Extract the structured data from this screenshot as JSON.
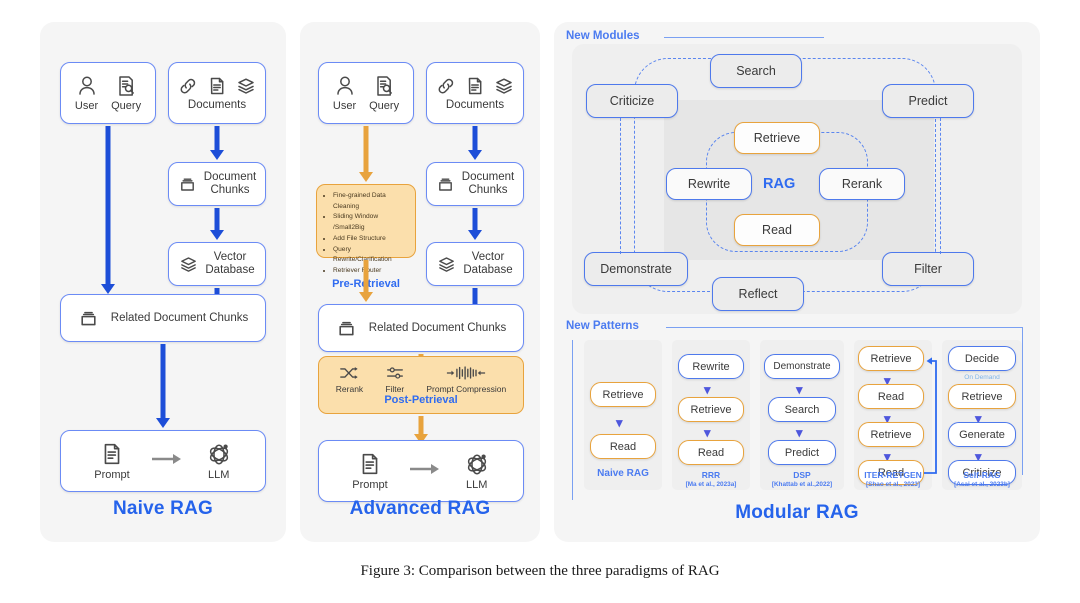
{
  "caption": "Figure 3: Comparison between the three paradigms of RAG",
  "colors": {
    "accent_blue": "#2563eb",
    "node_border_blue": "#6b8bf5",
    "arrow_blue": "#1d4ed8",
    "arrow_orange": "#e8a33d",
    "orange_fill": "#fbdfac",
    "panel_bg": "#f5f5f5",
    "module_bg": "#ececec"
  },
  "naive": {
    "title": "Naive RAG",
    "input_user": "User",
    "input_query": "Query",
    "input_documents": "Documents",
    "document_chunks": "Document\nChunks",
    "document_chunks_line1": "Document",
    "document_chunks_line2": "Chunks",
    "vector_database_line1": "Vector",
    "vector_database_line2": "Database",
    "related_chunks": "Related Document Chunks",
    "prompt": "Prompt",
    "llm": "LLM",
    "icons": [
      "user-icon",
      "query-icon",
      "link-icon",
      "document-icon",
      "layers-icon",
      "chunks-icon",
      "layers-icon",
      "prompt-icon",
      "llm-icon",
      "right-arrow-icon"
    ]
  },
  "advanced": {
    "title": "Advanced RAG",
    "input_user": "User",
    "input_query": "Query",
    "input_documents": "Documents",
    "document_chunks_line1": "Document",
    "document_chunks_line2": "Chunks",
    "vector_database_line1": "Vector",
    "vector_database_line2": "Database",
    "related_chunks": "Related Document Chunks",
    "pre_retrieval": {
      "label": "Pre-Retrieval",
      "bullets": [
        "Fine-grained Data Cleaning",
        "Sliding Window /Small2Big",
        "Add File Structure",
        "Query Rewrite/Clarification",
        "Retriever Router"
      ]
    },
    "post_retrieval": {
      "label": "Post-Petrieval",
      "items": [
        {
          "caption": "Rerank",
          "icon": "shuffle-icon"
        },
        {
          "caption": "Filter",
          "icon": "sliders-icon"
        },
        {
          "caption": "Prompt Compression",
          "icon": "compress-icon"
        }
      ]
    },
    "prompt": "Prompt",
    "llm": "LLM"
  },
  "modular": {
    "title": "Modular RAG",
    "new_modules_label": "New Modules",
    "new_patterns_label": "New Patterns",
    "rag_core_label": "RAG",
    "outer_modules": [
      {
        "name": "Search"
      },
      {
        "name": "Criticize"
      },
      {
        "name": "Predict"
      },
      {
        "name": "Demonstrate"
      },
      {
        "name": "Filter"
      },
      {
        "name": "Reflect"
      }
    ],
    "core_modules": [
      {
        "name": "Retrieve",
        "accent": "orange"
      },
      {
        "name": "Rewrite",
        "accent": "blue"
      },
      {
        "name": "Rerank",
        "accent": "blue"
      },
      {
        "name": "Read",
        "accent": "orange"
      }
    ],
    "patterns": [
      {
        "name": "Naive RAG",
        "citation": "",
        "steps": [
          {
            "label": "Retrieve",
            "accent": "orange"
          },
          {
            "label": "Read",
            "accent": "orange"
          }
        ]
      },
      {
        "name": "RRR",
        "citation": "[Ma et al., 2023a]",
        "steps": [
          {
            "label": "Rewrite",
            "accent": "blue"
          },
          {
            "label": "Retrieve",
            "accent": "orange"
          },
          {
            "label": "Read",
            "accent": "orange"
          }
        ]
      },
      {
        "name": "DSP",
        "citation": "[Khattab et al.,2022]",
        "steps": [
          {
            "label": "Demonstrate",
            "accent": "blue"
          },
          {
            "label": "Search",
            "accent": "blue"
          },
          {
            "label": "Predict",
            "accent": "blue"
          }
        ]
      },
      {
        "name": "ITER-RETGEN",
        "citation": "[Shao et al., 2023]",
        "steps": [
          {
            "label": "Retrieve",
            "accent": "orange"
          },
          {
            "label": "Read",
            "accent": "orange"
          },
          {
            "label": "Retrieve",
            "accent": "orange"
          },
          {
            "label": "Read",
            "accent": "orange"
          }
        ],
        "loop_back": true
      },
      {
        "name": "Self-RAG",
        "citation": "[Asai et al., 2023b]",
        "on_demand_label": "On Demand",
        "steps": [
          {
            "label": "Decide",
            "accent": "blue"
          },
          {
            "label": "Retrieve",
            "accent": "orange"
          },
          {
            "label": "Generate",
            "accent": "blue"
          },
          {
            "label": "Criticize",
            "accent": "blue"
          }
        ]
      }
    ]
  }
}
